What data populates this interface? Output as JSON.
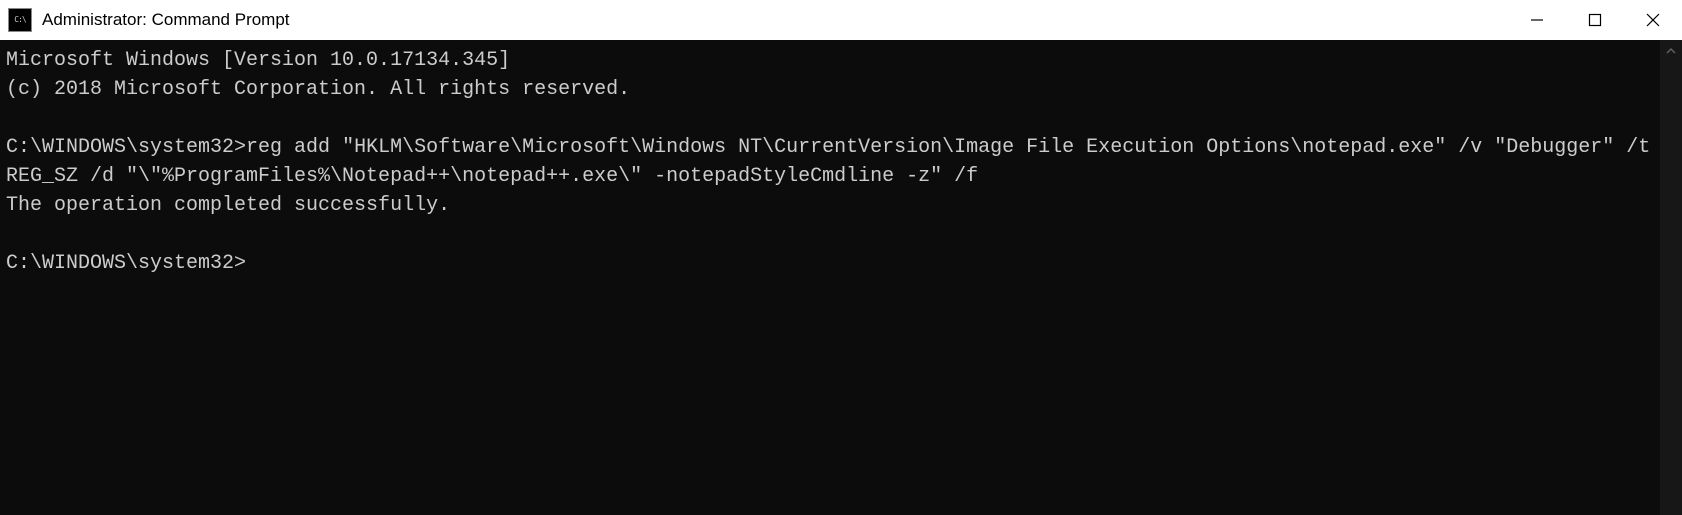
{
  "window": {
    "title": "Administrator: Command Prompt"
  },
  "console": {
    "line1": "Microsoft Windows [Version 10.0.17134.345]",
    "line2": "(c) 2018 Microsoft Corporation. All rights reserved.",
    "blank1": "",
    "prompt1": "C:\\WINDOWS\\system32>",
    "command1": "reg add \"HKLM\\Software\\Microsoft\\Windows NT\\CurrentVersion\\Image File Execution Options\\notepad.exe\" /v \"Debugger\" /t REG_SZ /d \"\\\"%ProgramFiles%\\Notepad++\\notepad++.exe\\\" -notepadStyleCmdline -z\" /f",
    "result1": "The operation completed successfully.",
    "blank2": "",
    "prompt2": "C:\\WINDOWS\\system32>"
  }
}
